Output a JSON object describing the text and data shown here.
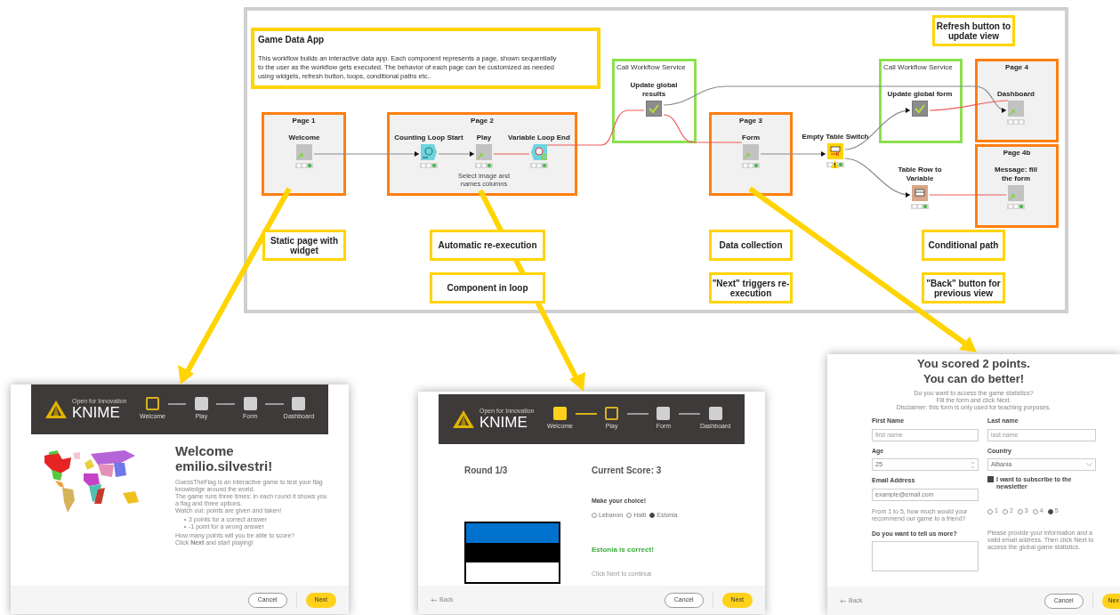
{
  "workflow": {
    "description": {
      "title": "Game Data App",
      "text": "This workflow builds an interactive data app. Each component represents a page, shown sequentially to the user as the workflow gets executed. The behavior of each page can be customized as needed using widgets, refresh button, loops, conditional paths etc.."
    },
    "groups": [
      {
        "kind": "page",
        "title": "Page 1"
      },
      {
        "kind": "page",
        "title": "Page 2"
      },
      {
        "kind": "service",
        "title": "Call Workflow Service"
      },
      {
        "kind": "page",
        "title": "Page 3"
      },
      {
        "kind": "service",
        "title": "Call Workflow Service"
      },
      {
        "kind": "page",
        "title": "Page 4"
      },
      {
        "kind": "page",
        "title": "Page 4b"
      }
    ],
    "nodes": [
      {
        "kind": "component",
        "label": "Welcome",
        "executed": true
      },
      {
        "kind": "loop_start",
        "label": "Counting Loop Start",
        "executed": true
      },
      {
        "kind": "component",
        "label": "Play",
        "executed": true,
        "note": "Select image and names columns"
      },
      {
        "kind": "loop_end",
        "label": "Variable Loop End",
        "executed": true
      },
      {
        "kind": "service",
        "label": "Update global results"
      },
      {
        "kind": "component",
        "label": "Form",
        "executed": true
      },
      {
        "kind": "switch",
        "label": "Empty Table Switch",
        "executed": true,
        "warning": true
      },
      {
        "kind": "service",
        "label": "Update global form"
      },
      {
        "kind": "component",
        "label": "Dashboard",
        "executed": false
      },
      {
        "kind": "row_to_variable",
        "label": "Table Row to Variable",
        "executed": true
      },
      {
        "kind": "component",
        "label": "Message: fill the form",
        "executed": true
      }
    ],
    "annotations": [
      {
        "text": "Refresh button to update view"
      },
      {
        "text": "Static page with widget"
      },
      {
        "text": "Automatic re-execution"
      },
      {
        "text": "Component in loop"
      },
      {
        "text": "Data collection"
      },
      {
        "text": "\"Next\" triggers re-execution"
      },
      {
        "text": "Conditional path"
      },
      {
        "text": "\"Back\" button for previous view"
      }
    ]
  },
  "welcome_screen": {
    "logo": {
      "tagline": "Open for Innovation",
      "name": "KNIME"
    },
    "steps": [
      {
        "label": "Welcome",
        "selected": true,
        "completed": false
      },
      {
        "label": "Play",
        "selected": false,
        "completed": false
      },
      {
        "label": "Form",
        "selected": false,
        "completed": false
      },
      {
        "label": "Dashboard",
        "selected": false,
        "completed": false
      }
    ],
    "heading": "Welcome emilio.silvestri!",
    "paragraphs": [
      "GuessTheFlag is an interactive game to test your flag knowledge around the world.",
      "The game runs three times: in each round it shows you a flag and three options.",
      "Watch out: points are given and taken!"
    ],
    "bullets": [
      "3 points for a correct answer",
      "-1 point for a wrong answer"
    ],
    "closing": [
      "How many points will you be able to score?",
      "Click **Next** and start playing!"
    ],
    "cancel": "Cancel",
    "next": "Next"
  },
  "play_screen": {
    "logo": {
      "tagline": "Open for Innovation",
      "name": "KNIME"
    },
    "steps": [
      {
        "label": "Welcome",
        "selected": false,
        "completed": true
      },
      {
        "label": "Play",
        "selected": true,
        "completed": false
      },
      {
        "label": "Form",
        "selected": false,
        "completed": false
      },
      {
        "label": "Dashboard",
        "selected": false,
        "completed": false
      }
    ],
    "round": "Round 1/3",
    "score": "Current Score: 3",
    "prompt": "Make your choice!",
    "options": [
      {
        "label": "Lebanon",
        "selected": false
      },
      {
        "label": "Haiti",
        "selected": false
      },
      {
        "label": "Estonia",
        "selected": true
      }
    ],
    "result": "Estonia is correct!",
    "hint": "Click Next to continue",
    "back": "Back",
    "cancel": "Cancel",
    "next": "Next"
  },
  "form_screen": {
    "heading": [
      "You scored 2 points.",
      "You can do better!"
    ],
    "intro": [
      "Do you want to access the game statistics?",
      "Fill the form and click Next.",
      "Disclaimer: this form is only used for teaching purposes."
    ],
    "first_name": {
      "label": "First Name",
      "placeholder": "first name"
    },
    "last_name": {
      "label": "Last name",
      "placeholder": "last name"
    },
    "age": {
      "label": "Age",
      "value": "25"
    },
    "country": {
      "label": "Country",
      "value": "Albania"
    },
    "email": {
      "label": "Email Address",
      "placeholder": "example@email.com"
    },
    "newsletter": {
      "label": "I want to subscribe to the newsletter",
      "checked": true
    },
    "rating": {
      "question": "From 1 to 5, how much would your recommend our game to a friend?",
      "options": [
        {
          "label": "1",
          "selected": false
        },
        {
          "label": "2",
          "selected": false
        },
        {
          "label": "3",
          "selected": false
        },
        {
          "label": "4",
          "selected": false
        },
        {
          "label": "5",
          "selected": true
        }
      ]
    },
    "more": {
      "label": "Do you want to tell us more?"
    },
    "note": "Please provide your information and a valid email address. Then click Next to access the global game statistics.",
    "back": "Back",
    "cancel": "Cancel",
    "next": "Nex"
  }
}
